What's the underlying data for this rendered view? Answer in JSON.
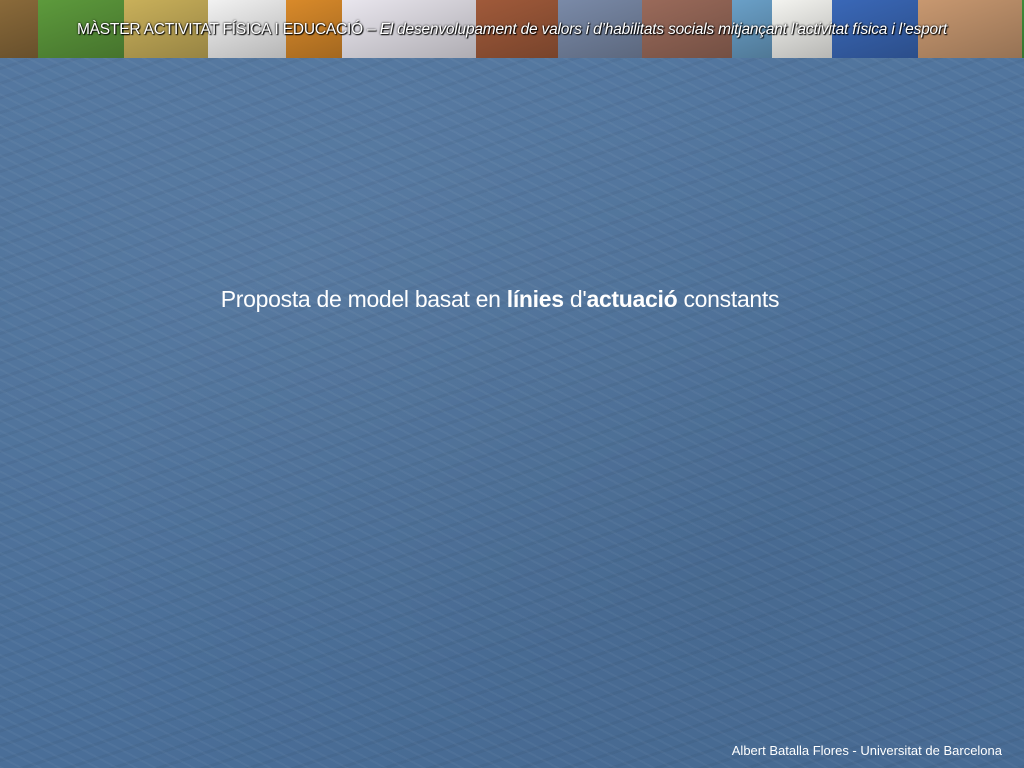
{
  "banner": {
    "title_main": "MÀSTER ACTIVITAT FÍSICA I EDUCACIÓ",
    "title_separator": " – ",
    "title_sub": "El desenvolupament de valors i d’habilitats socials mitjançant l’activitat física i l’esport",
    "photos": [
      {
        "name": "kids-photo-icon",
        "color": "#8a6a3a"
      },
      {
        "name": "hands-plant-photo-icon",
        "color": "#5d9a3c"
      },
      {
        "name": "kids-basketball-photo-icon",
        "color": "#c9b05a"
      },
      {
        "name": "orange-figure-icon",
        "color": "#f2f2f2"
      },
      {
        "name": "silhouettes-sunset-icon",
        "color": "#d98a2a"
      },
      {
        "name": "cartoon-kids-icon",
        "color": "#e9e6ee"
      },
      {
        "name": "kids-gym-photo-icon",
        "color": "#a05a3a"
      },
      {
        "name": "kids-court-photo-icon",
        "color": "#7a8aa8"
      },
      {
        "name": "kids-jumping-photo-icon",
        "color": "#9a6a5a"
      },
      {
        "name": "children-play-photo-icon",
        "color": "#6aa0c8"
      },
      {
        "name": "faces-drawing-icon",
        "color": "#f4f4f0"
      },
      {
        "name": "hands-together-photo-icon",
        "color": "#3a68b8"
      },
      {
        "name": "boy-smiling-photo-icon",
        "color": "#c89870"
      },
      {
        "name": "soccer-team-photo-icon",
        "color": "#3f8a3a"
      }
    ]
  },
  "heading": {
    "part1": "Proposta de model basat en ",
    "bold1": "línies",
    "part2": " d'",
    "bold2": "actuació",
    "part3": " constants"
  },
  "footer": {
    "author": "Albert Batalla Flores - Universitat de Barcelona"
  },
  "colors": {
    "background": "#4e729b",
    "text": "#ffffff"
  }
}
